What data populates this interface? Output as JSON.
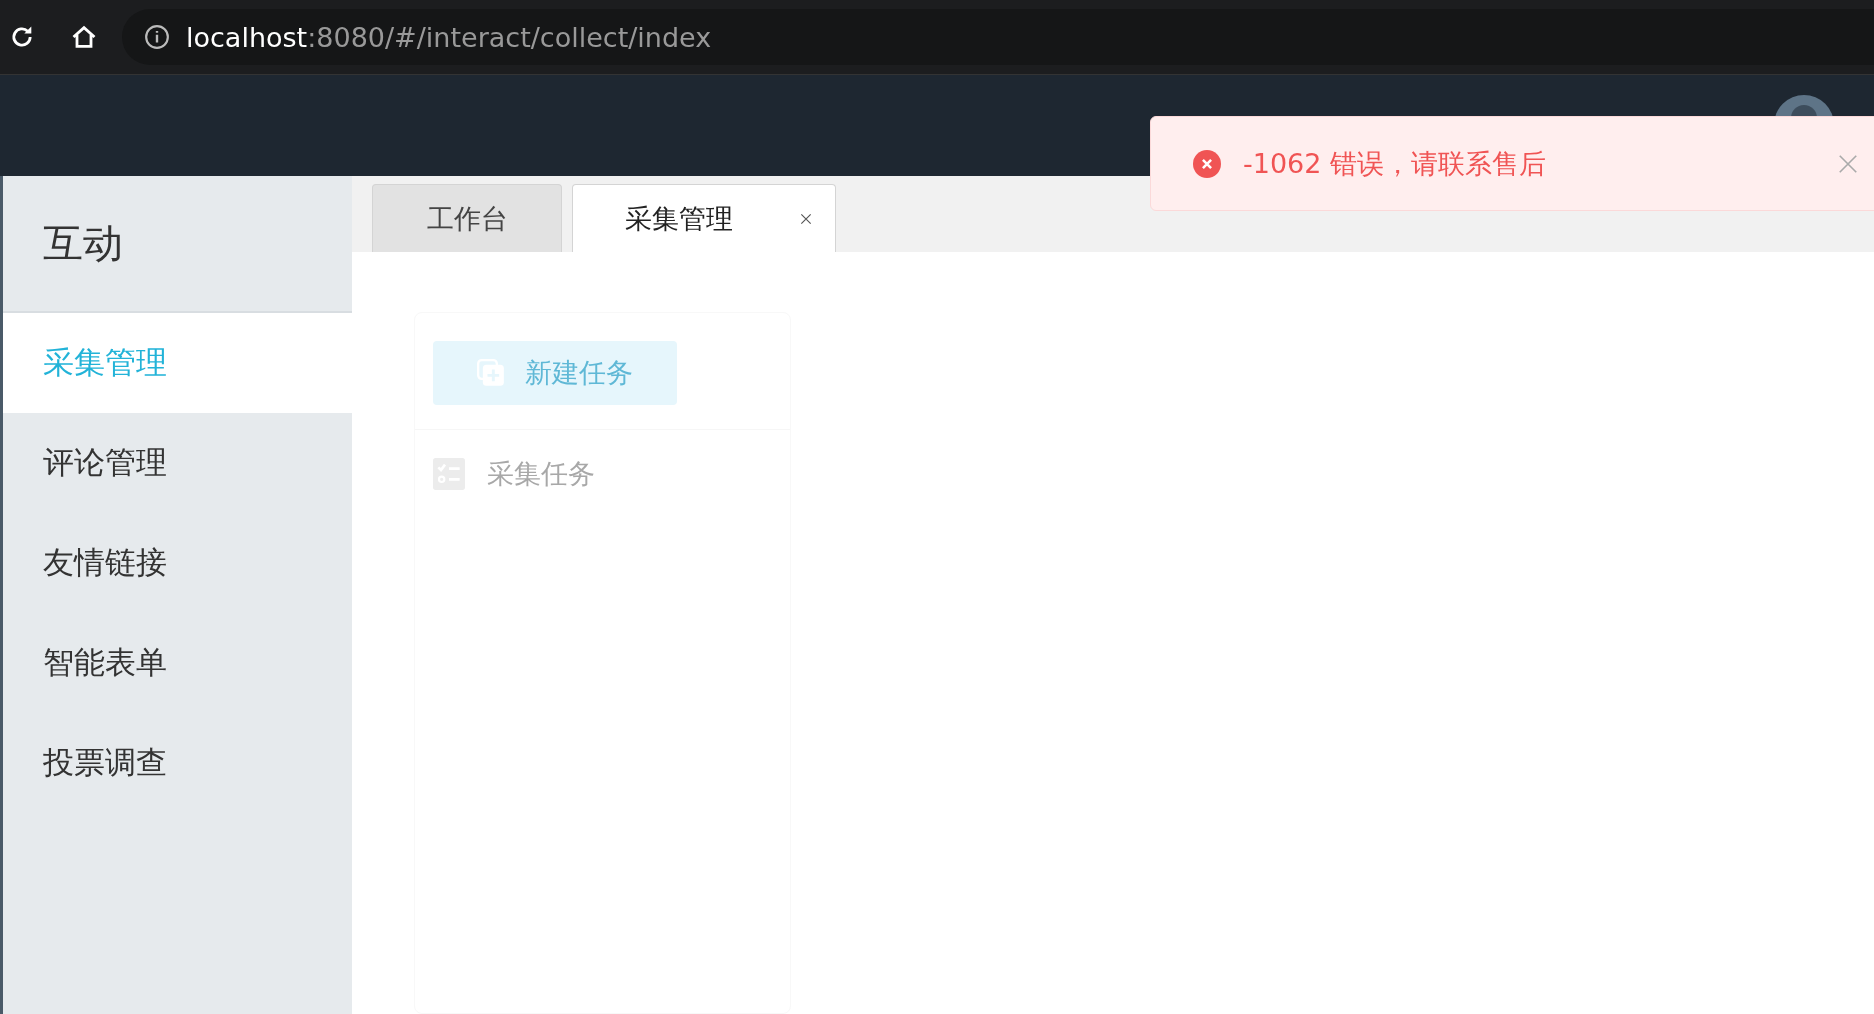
{
  "browser": {
    "host": "localhost",
    "path": ":8080/#/interact/collect/index"
  },
  "sidebar": {
    "title": "互动",
    "items": [
      {
        "label": "采集管理",
        "selected": true
      },
      {
        "label": "评论管理",
        "selected": false
      },
      {
        "label": "友情链接",
        "selected": false
      },
      {
        "label": "智能表单",
        "selected": false
      },
      {
        "label": "投票调查",
        "selected": false
      }
    ]
  },
  "tabs": [
    {
      "label": "工作台",
      "selected": false,
      "closable": false
    },
    {
      "label": "采集管理",
      "selected": true,
      "closable": true
    }
  ],
  "content": {
    "button": "新建任务",
    "section_title": "采集任务"
  },
  "toast": {
    "kind": "error",
    "message": "-1062 错误，请联系售后"
  }
}
